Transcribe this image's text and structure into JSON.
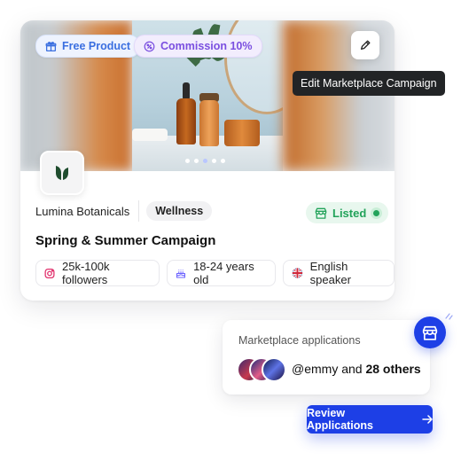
{
  "hero": {
    "free_product_label": "Free Product",
    "commission_label": "Commission 10%",
    "edit_tooltip": "Edit Marketplace Campaign",
    "carousel_dots": 5,
    "carousel_active_index": 2
  },
  "brand": {
    "name": "Lumina Botanicals",
    "category": "Wellness",
    "status": "Listed",
    "logo_icon": "leaf-logo-icon"
  },
  "campaign": {
    "title": "Spring & Summer Campaign",
    "tags": [
      {
        "icon": "instagram-icon",
        "label": "25k-100k followers"
      },
      {
        "icon": "cake-icon",
        "label": "18-24 years old"
      },
      {
        "icon": "uk-flag-icon",
        "label": "English speaker"
      }
    ]
  },
  "applications": {
    "label": "Marketplace applications",
    "handle": "@emmy",
    "rest": " and ",
    "others": "28 others",
    "button_label": "Review Applications"
  },
  "colors": {
    "accent": "#1d3fe6",
    "listed": "#22a35a",
    "free_product": "#3a6fe0",
    "commission": "#7a4fe0"
  }
}
